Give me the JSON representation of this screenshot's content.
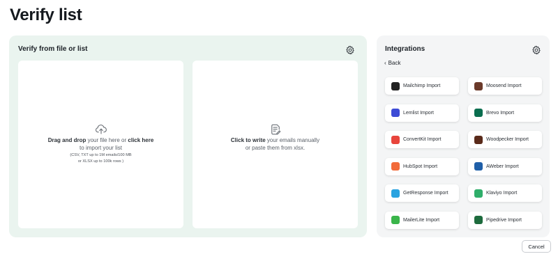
{
  "page": {
    "title": "Verify list"
  },
  "verify": {
    "title": "Verify from file or list",
    "upload": {
      "drag_bold": "Drag and drop",
      "drag_mid": " your file here or ",
      "click_bold": "click here",
      "drag_end": " to import your list",
      "formats_line1": "(CSV, TXT up to 1M emails/100 MB",
      "formats_line2": "or XLSX up to 100k rows )"
    },
    "manual": {
      "click_bold": "Click to write",
      "text_mid": " your emails manually",
      "text_line2": "or paste them from xlsx."
    }
  },
  "integrations": {
    "title": "Integrations",
    "back_label": "Back",
    "items": [
      {
        "label": "Mailchimp Import",
        "icon": "mailchimp-icon",
        "color": "#222222"
      },
      {
        "label": "Moosend Import",
        "icon": "moosend-icon",
        "color": "#6b3a2a"
      },
      {
        "label": "Lemlist Import",
        "icon": "lemlist-icon",
        "color": "#3d4bd6"
      },
      {
        "label": "Brevo Import",
        "icon": "brevo-icon",
        "color": "#0b6e4f"
      },
      {
        "label": "ConvertKit Import",
        "icon": "convertkit-icon",
        "color": "#e8453c"
      },
      {
        "label": "Woodpecker Import",
        "icon": "woodpecker-icon",
        "color": "#5a2a1a"
      },
      {
        "label": "HubSpot Import",
        "icon": "hubspot-icon",
        "color": "#f26b3a"
      },
      {
        "label": "AWeber Import",
        "icon": "aweber-icon",
        "color": "#1f5fa8"
      },
      {
        "label": "GetResponse Import",
        "icon": "getresponse-icon",
        "color": "#2aa3e0"
      },
      {
        "label": "Klaviyo Import",
        "icon": "klaviyo-icon",
        "color": "#2fae6a"
      },
      {
        "label": "MailerLite Import",
        "icon": "mailerlite-icon",
        "color": "#3ab54a"
      },
      {
        "label": "Pipedrive Import",
        "icon": "pipedrive-icon",
        "color": "#1d6b3d"
      }
    ]
  },
  "footer": {
    "cancel_label": "Cancel"
  }
}
